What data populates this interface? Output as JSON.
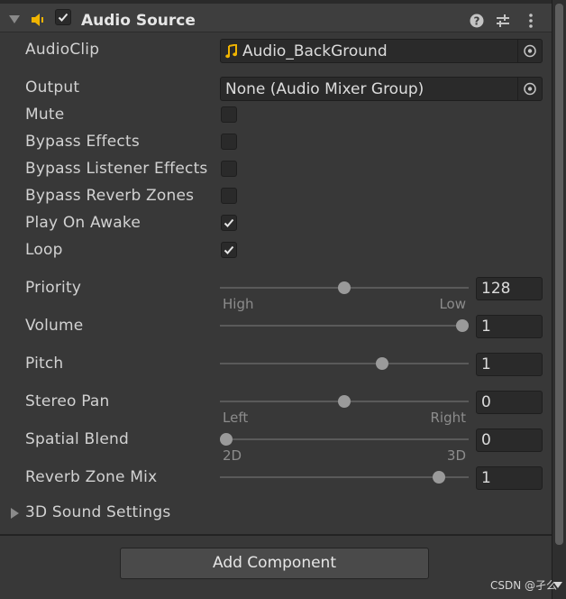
{
  "component": {
    "title": "Audio Source",
    "enabled": true,
    "icons": [
      "foldout-arrow-icon",
      "speaker-icon",
      "help-icon",
      "presets-icon",
      "more-options-icon"
    ]
  },
  "fields": {
    "audioclip": {
      "label": "AudioClip",
      "value": "Audio_BackGround",
      "icon": "music-note-icon"
    },
    "output": {
      "label": "Output",
      "value": "None (Audio Mixer Group)"
    },
    "mute": {
      "label": "Mute",
      "checked": false
    },
    "bypass_effects": {
      "label": "Bypass Effects",
      "checked": false
    },
    "bypass_listener_effects": {
      "label": "Bypass Listener Effects",
      "checked": false
    },
    "bypass_reverb_zones": {
      "label": "Bypass Reverb Zones",
      "checked": false
    },
    "play_on_awake": {
      "label": "Play On Awake",
      "checked": true
    },
    "loop": {
      "label": "Loop",
      "checked": true
    }
  },
  "sliders": {
    "priority": {
      "label": "Priority",
      "value": "128",
      "position": 0.5,
      "min_label": "High",
      "max_label": "Low"
    },
    "volume": {
      "label": "Volume",
      "value": "1",
      "position": 1.0
    },
    "pitch": {
      "label": "Pitch",
      "value": "1",
      "position": 0.66
    },
    "stereo_pan": {
      "label": "Stereo Pan",
      "value": "0",
      "position": 0.5,
      "min_label": "Left",
      "max_label": "Right"
    },
    "spatial_blend": {
      "label": "Spatial Blend",
      "value": "0",
      "position": 0.0,
      "min_label": "2D",
      "max_label": "3D"
    },
    "reverb_zone_mix": {
      "label": "Reverb Zone Mix",
      "value": "1",
      "position": 0.9
    }
  },
  "sound_3d": {
    "label": "3D Sound Settings"
  },
  "add_component": {
    "label": "Add Component"
  },
  "watermark": {
    "text": "CSDN @孑么"
  },
  "colors": {
    "background": "#383838",
    "field_bg": "#2a2a2a",
    "music_note": "#f0b400",
    "speaker": "#f0b400"
  }
}
